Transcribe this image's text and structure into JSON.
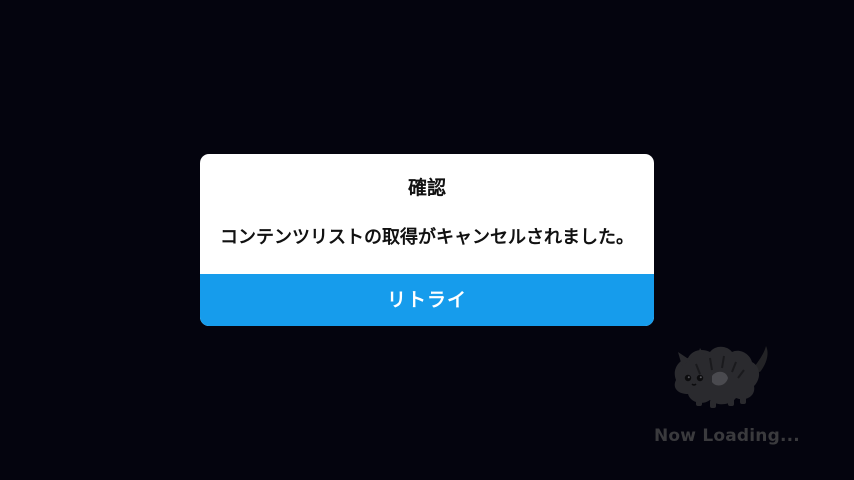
{
  "dialog": {
    "title": "確認",
    "message": "コンテンツリストの取得がキャンセルされました。",
    "retry_label": "リトライ"
  },
  "loading": {
    "text": "Now Loading...",
    "icon": "fluffy-creature-icon"
  },
  "colors": {
    "background": "#04040e",
    "dialog_background": "#ffffff",
    "button": "#169cec",
    "button_text": "#ffffff",
    "loading_text": "#3a3a3d"
  }
}
